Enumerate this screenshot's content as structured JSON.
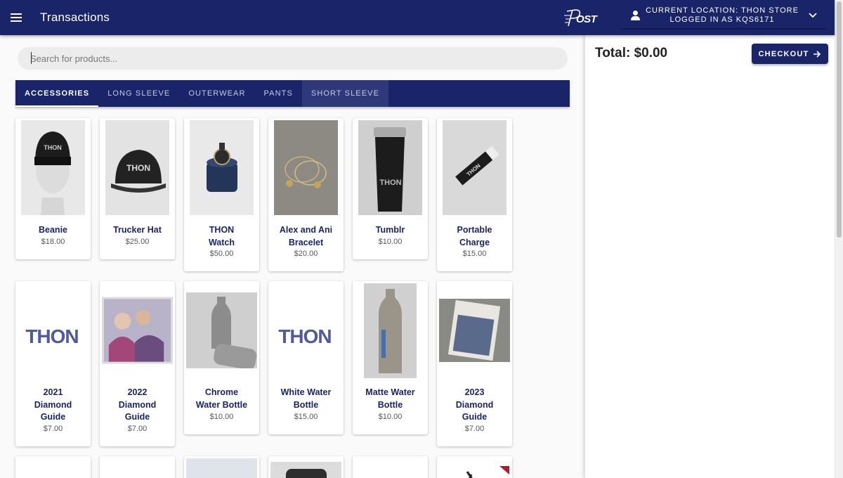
{
  "header": {
    "title": "Transactions",
    "logo_text": "OST",
    "location_line": "CURRENT LOCATION: THON STORE",
    "user_line": "LOGGED IN AS KQS6171"
  },
  "search": {
    "placeholder": "Search for products...",
    "value": ""
  },
  "tabs": [
    {
      "label": "ACCESSORIES",
      "active": true
    },
    {
      "label": "LONG SLEEVE",
      "active": false
    },
    {
      "label": "OUTERWEAR",
      "active": false
    },
    {
      "label": "PANTS",
      "active": false
    },
    {
      "label": "SHORT SLEEVE",
      "active": false
    }
  ],
  "cart": {
    "total": "Total: $0.00",
    "checkout_label": "CHECKOUT"
  },
  "products": [
    {
      "name_lines": [
        "Beanie"
      ],
      "price": "$18.00",
      "image": "beanie-photo"
    },
    {
      "name_lines": [
        "Trucker Hat"
      ],
      "price": "$25.00",
      "image": "trucker-hat-photo"
    },
    {
      "name_lines": [
        "THON",
        "Watch"
      ],
      "price": "$50.00",
      "image": "watch-photo"
    },
    {
      "name_lines": [
        "Alex and Ani",
        "Bracelet"
      ],
      "price": "$20.00",
      "image": "bracelet-photo"
    },
    {
      "name_lines": [
        "Tumblr"
      ],
      "price": "$10.00",
      "image": "tumbler-photo"
    },
    {
      "name_lines": [
        "Portable",
        "Charge"
      ],
      "price": "$15.00",
      "image": "charger-photo"
    },
    {
      "name_lines": [
        "2021",
        "Diamond",
        "Guide"
      ],
      "price": "$7.00",
      "image": "thon-logo",
      "logo_text": "THON"
    },
    {
      "name_lines": [
        "2022",
        "Diamond",
        "Guide"
      ],
      "price": "$7.00",
      "image": "guide-2022-photo"
    },
    {
      "name_lines": [
        "Chrome",
        "Water Bottle"
      ],
      "price": "$10.00",
      "image": "chrome-bottle-photo"
    },
    {
      "name_lines": [
        "White Water",
        "Bottle"
      ],
      "price": "$15.00",
      "image": "thon-logo",
      "logo_text": "THON"
    },
    {
      "name_lines": [
        "Matte Water",
        "Bottle"
      ],
      "price": "$10.00",
      "image": "matte-bottle-photo"
    },
    {
      "name_lines": [
        "2023",
        "Diamond",
        "Guide"
      ],
      "price": "$7.00",
      "image": "guide-2023-photo"
    }
  ],
  "colors": {
    "primary": "#1a2468",
    "background": "#fafafa",
    "card": "#ffffff"
  }
}
